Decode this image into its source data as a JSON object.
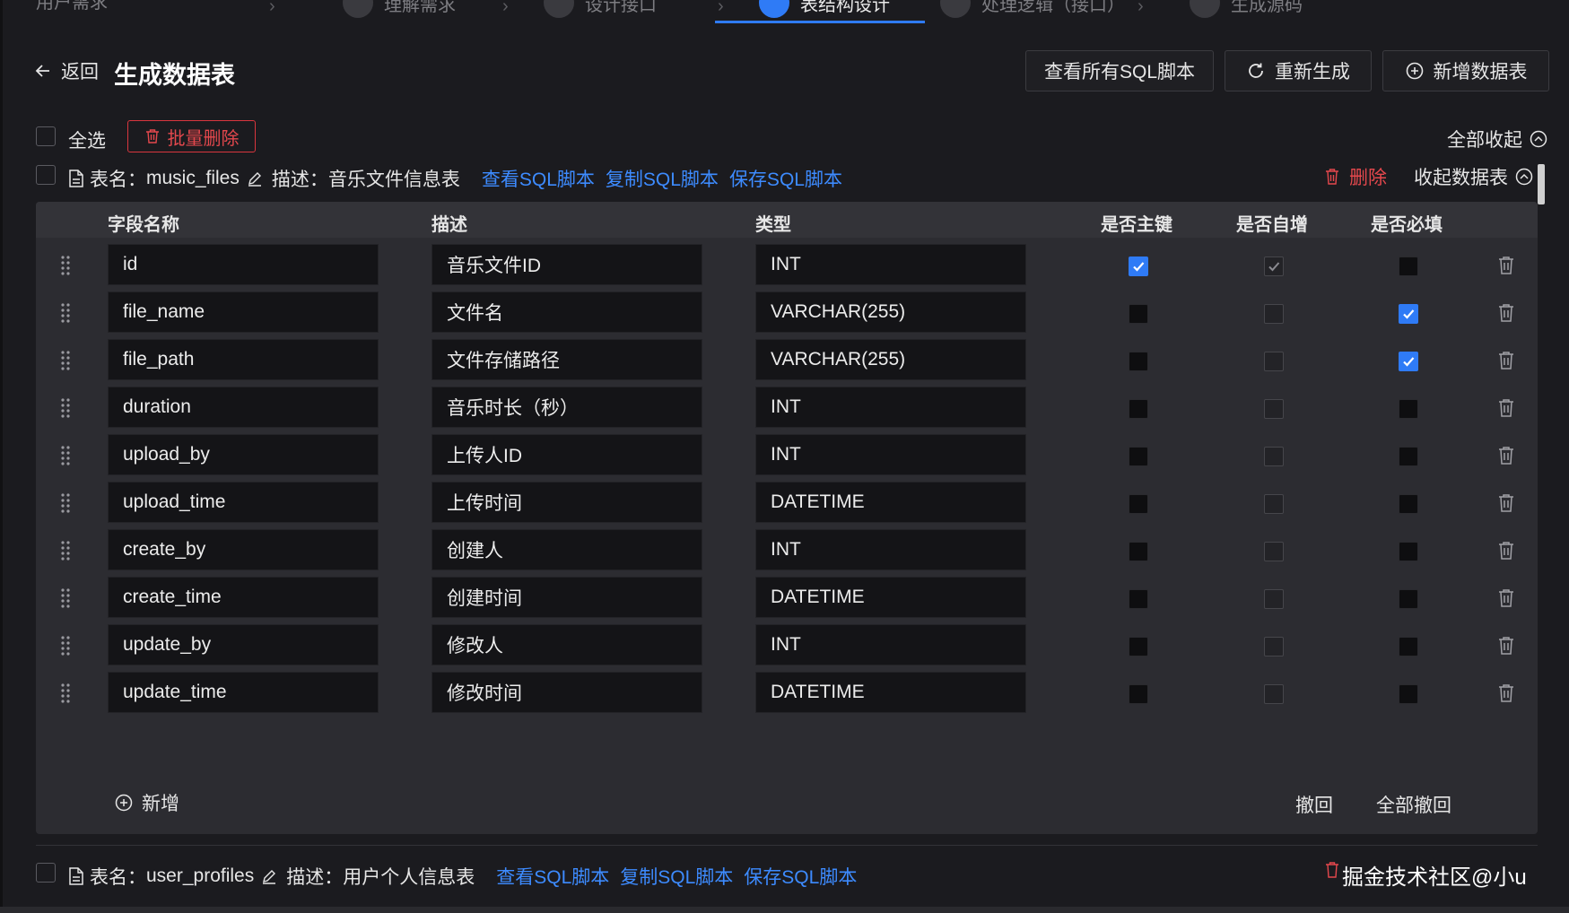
{
  "steps": [
    {
      "label": "用户需求",
      "state": "done"
    },
    {
      "label": "理解需求",
      "state": "done"
    },
    {
      "label": "设计接口",
      "state": "done"
    },
    {
      "label": "表结构设计",
      "state": "active"
    },
    {
      "label": "处理逻辑（接口）",
      "state": "todo"
    },
    {
      "label": "生成源码",
      "state": "todo"
    }
  ],
  "header": {
    "back_label": "返回",
    "title": "生成数据表",
    "buttons": {
      "view_all_sql": "查看所有SQL脚本",
      "regenerate": "重新生成",
      "add_table": "新增数据表"
    }
  },
  "toolbar": {
    "select_all": "全选",
    "batch_delete": "批量删除",
    "collapse_all": "全部收起"
  },
  "tables": [
    {
      "name_prefix": "表名：",
      "name": "music_files",
      "desc_prefix": "描述：",
      "desc": "音乐文件信息表",
      "links": [
        "查看SQL脚本",
        "复制SQL脚本",
        "保存SQL脚本"
      ],
      "delete_label": "删除",
      "collapse_label": "收起数据表",
      "columns": [
        "字段名称",
        "描述",
        "类型",
        "是否主键",
        "是否自增",
        "是否必填"
      ],
      "rows": [
        {
          "field": "id",
          "desc": "音乐文件ID",
          "type": "INT",
          "pk": "on",
          "auto": "dis-on",
          "req": "off"
        },
        {
          "field": "file_name",
          "desc": "文件名",
          "type": "VARCHAR(255)",
          "pk": "off",
          "auto": "dis",
          "req": "on"
        },
        {
          "field": "file_path",
          "desc": "文件存储路径",
          "type": "VARCHAR(255)",
          "pk": "off",
          "auto": "dis",
          "req": "on"
        },
        {
          "field": "duration",
          "desc": "音乐时长（秒）",
          "type": "INT",
          "pk": "off",
          "auto": "dis",
          "req": "off"
        },
        {
          "field": "upload_by",
          "desc": "上传人ID",
          "type": "INT",
          "pk": "off",
          "auto": "dis",
          "req": "off"
        },
        {
          "field": "upload_time",
          "desc": "上传时间",
          "type": "DATETIME",
          "pk": "off",
          "auto": "dis",
          "req": "off"
        },
        {
          "field": "create_by",
          "desc": "创建人",
          "type": "INT",
          "pk": "off",
          "auto": "dis",
          "req": "off"
        },
        {
          "field": "create_time",
          "desc": "创建时间",
          "type": "DATETIME",
          "pk": "off",
          "auto": "dis",
          "req": "off"
        },
        {
          "field": "update_by",
          "desc": "修改人",
          "type": "INT",
          "pk": "off",
          "auto": "dis",
          "req": "off"
        },
        {
          "field": "update_time",
          "desc": "修改时间",
          "type": "DATETIME",
          "pk": "off",
          "auto": "dis",
          "req": "off"
        }
      ],
      "add_label": "新增",
      "undo_label": "撤回",
      "undo_all_label": "全部撤回"
    },
    {
      "name_prefix": "表名：",
      "name": "user_profiles",
      "desc_prefix": "描述：",
      "desc": "用户个人信息表",
      "links": [
        "查看SQL脚本",
        "复制SQL脚本",
        "保存SQL脚本"
      ]
    }
  ],
  "watermark": "掘金技术社区@小u",
  "colors": {
    "accent": "#2f7bf6",
    "danger": "#e5484d",
    "link": "#3d8bff"
  }
}
